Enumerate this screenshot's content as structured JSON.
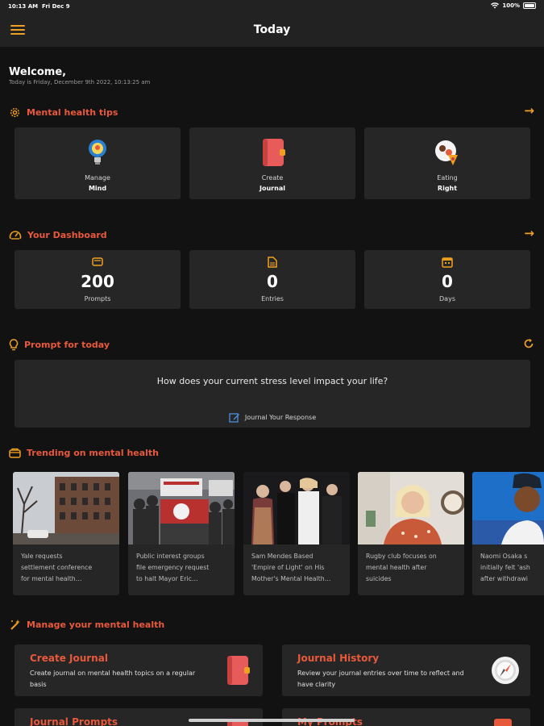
{
  "status": {
    "time": "10:13 AM",
    "date": "Fri Dec 9",
    "battery": "100%"
  },
  "appbar": {
    "title": "Today"
  },
  "welcome": {
    "title": "Welcome,",
    "date_line": "Today is Friday, December 9th 2022, 10:13:25 am"
  },
  "tips": {
    "title": "Mental health tips",
    "items": [
      {
        "line1": "Manage",
        "line2": "Mind",
        "icon": "brain-bulb-icon"
      },
      {
        "line1": "Create",
        "line2": "Journal",
        "icon": "journal-book-icon"
      },
      {
        "line1": "Eating",
        "line2": "Right",
        "icon": "healthy-food-icon"
      }
    ]
  },
  "dashboard": {
    "title": "Your Dashboard",
    "items": [
      {
        "value": "200",
        "label": "Prompts",
        "icon": "prompts-icon"
      },
      {
        "value": "0",
        "label": "Entries",
        "icon": "document-icon"
      },
      {
        "value": "0",
        "label": "Days",
        "icon": "calendar-icon"
      }
    ]
  },
  "prompt": {
    "title": "Prompt for today",
    "question": "How does your current stress level impact your life?",
    "action": "Journal Your Response"
  },
  "trending": {
    "title": "Trending on mental health",
    "items": [
      {
        "caption": "Yale requests\nsettlement conference\nfor mental health…"
      },
      {
        "caption": "Public interest groups\nfile emergency request\nto halt Mayor Eric…"
      },
      {
        "caption": "Sam Mendes Based\n'Empire of Light' on His\nMother's Mental Health…"
      },
      {
        "caption": "Rugby club focuses on\nmental health after\nsuicides"
      },
      {
        "caption": "Naomi Osaka s\ninitially felt 'ash\nafter withdrawi"
      }
    ]
  },
  "manage": {
    "title": "Manage your mental health",
    "cards": [
      {
        "title": "Create Journal",
        "desc": "Create journal on mental health topics on a regular basis",
        "icon": "journal-book-icon"
      },
      {
        "title": "Journal History",
        "desc": "Review your journal entries over time to reflect and have clarity",
        "icon": "compass-icon"
      },
      {
        "title": "Journal Prompts",
        "desc": "",
        "icon": "journal-book-icon"
      },
      {
        "title": "My Prompts",
        "desc": "",
        "icon": "prompts-icon"
      }
    ]
  },
  "colors": {
    "accent": "#e8593c",
    "icon_orange": "#f0a020",
    "card": "#262626",
    "background": "#121212"
  }
}
